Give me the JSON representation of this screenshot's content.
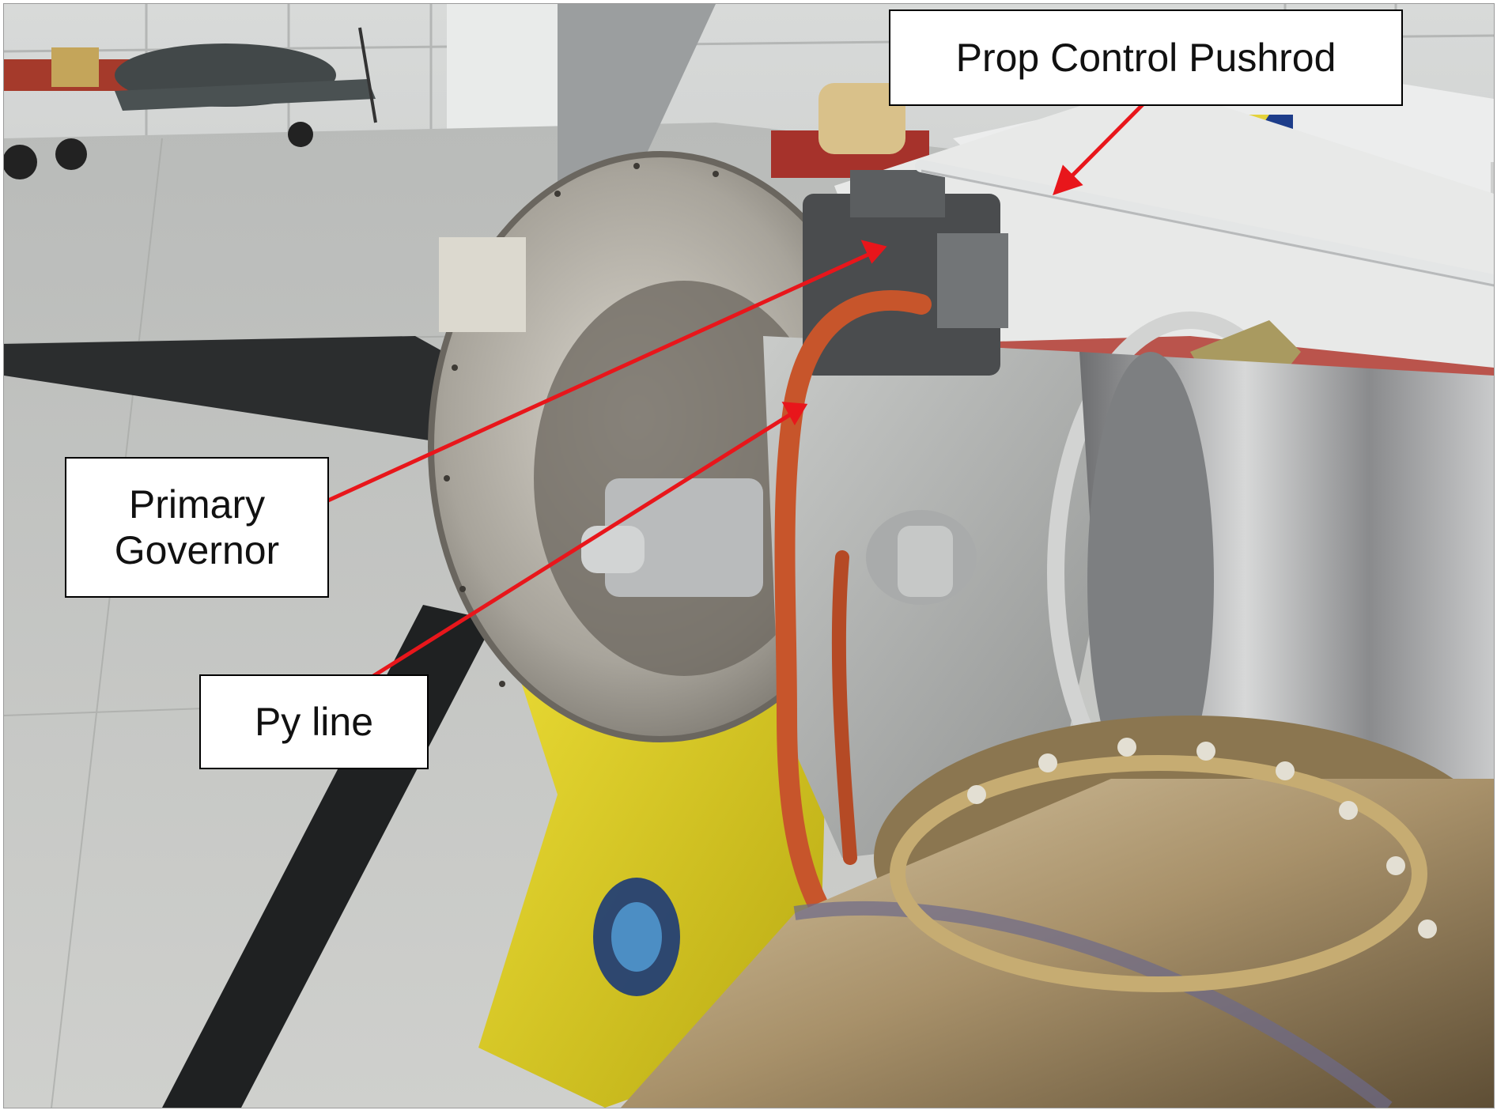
{
  "figure": {
    "callouts": {
      "prop_control_pushrod": "Prop Control Pushrod",
      "primary_governor_line1": "Primary",
      "primary_governor_line2": "Governor",
      "py_line": "Py line"
    },
    "colors": {
      "arrow": "#e8161b",
      "callout_border": "#000000",
      "callout_fill": "#ffffff",
      "spinner_backplate": "#b4b0a6",
      "cowling_yellow": "#e6d61f",
      "py_hose_orange": "#c7552b",
      "exhaust_bronze": "#a8916a",
      "hangar_floor": "#c3c4c2"
    }
  }
}
